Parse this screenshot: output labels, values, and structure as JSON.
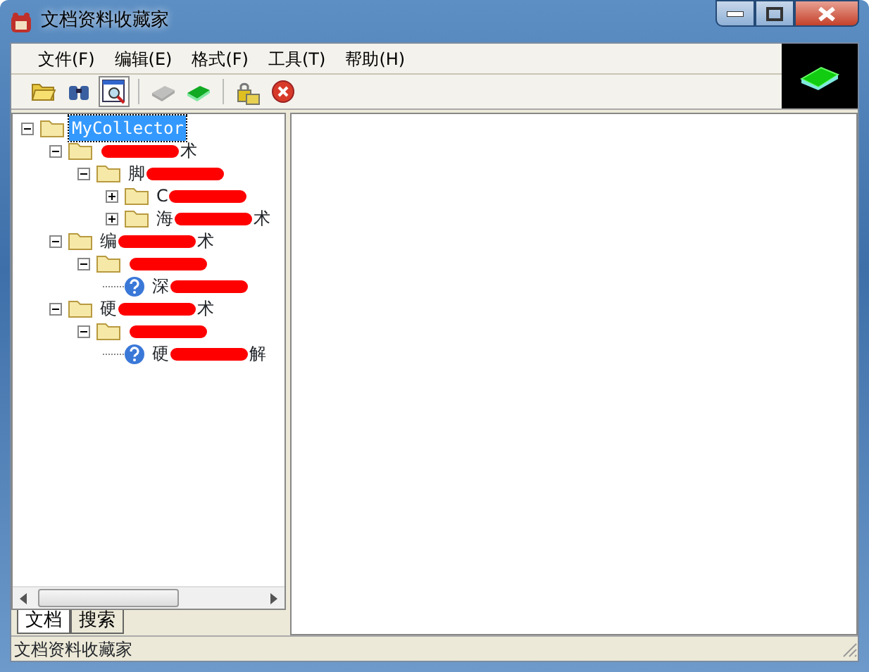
{
  "window": {
    "title": "文档资料收藏家"
  },
  "menu": [
    {
      "label": "文件(F)"
    },
    {
      "label": "编辑(E)"
    },
    {
      "label": "格式(F)"
    },
    {
      "label": "工具(T)"
    },
    {
      "label": "帮助(H)"
    }
  ],
  "toolbar": [
    {
      "kind": "open",
      "pressed": false,
      "disabled": false
    },
    {
      "kind": "find",
      "pressed": false,
      "disabled": false
    },
    {
      "kind": "preview",
      "pressed": true,
      "disabled": false
    },
    {
      "kind": "sep"
    },
    {
      "kind": "book",
      "pressed": false,
      "disabled": true
    },
    {
      "kind": "book",
      "pressed": false,
      "disabled": false
    },
    {
      "kind": "sep"
    },
    {
      "kind": "lock",
      "pressed": false,
      "disabled": false
    },
    {
      "kind": "stop",
      "pressed": false,
      "disabled": false
    }
  ],
  "tree": [
    {
      "kind": "folder",
      "label": "MyCollector",
      "selected": true,
      "expanded": true,
      "children": [
        {
          "kind": "folder",
          "suffix": "术",
          "redacted": true,
          "selected": false,
          "expanded": true,
          "children": [
            {
              "kind": "folder",
              "prefix": "脚",
              "redacted": true,
              "selected": false,
              "expanded": true,
              "children": [
                {
                  "kind": "folder",
                  "prefix": "C",
                  "redacted": true,
                  "selected": false,
                  "expanded": false
                },
                {
                  "kind": "folder",
                  "prefix": "海",
                  "suffix": "术",
                  "redacted": true,
                  "selected": false,
                  "expanded": false
                }
              ]
            }
          ]
        },
        {
          "kind": "folder",
          "prefix": "编",
          "suffix": "术",
          "redacted": true,
          "selected": false,
          "expanded": true,
          "children": [
            {
              "kind": "folder",
              "redacted": true,
              "selected": false,
              "expanded": true,
              "children": [
                {
                  "kind": "doc",
                  "prefix": "深",
                  "redacted": true,
                  "selected": false
                }
              ]
            }
          ]
        },
        {
          "kind": "folder",
          "prefix": "硬",
          "suffix": "术",
          "redacted": true,
          "selected": false,
          "expanded": true,
          "children": [
            {
              "kind": "folder",
              "redacted": true,
              "selected": false,
              "expanded": true,
              "children": [
                {
                  "kind": "doc",
                  "prefix": "硬",
                  "suffix": "解",
                  "redacted": true,
                  "selected": false
                }
              ]
            }
          ]
        }
      ]
    }
  ],
  "tabs": [
    {
      "label": "文档",
      "selected": true
    },
    {
      "label": "搜索",
      "selected": false
    }
  ],
  "status_bar": "文档资料收藏家"
}
